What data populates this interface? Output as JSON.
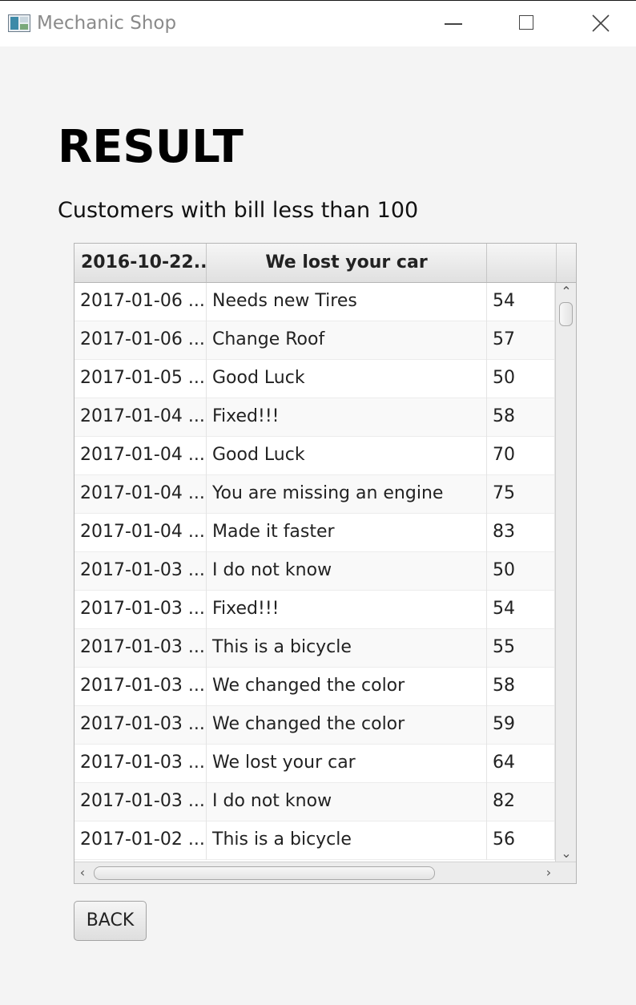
{
  "window": {
    "title": "Mechanic Shop",
    "icon": "app-window-icon",
    "controls": [
      "minimize-icon",
      "maximize-icon",
      "close-icon"
    ]
  },
  "page": {
    "heading": "RESULT",
    "subheading": "Customers with bill less than 100"
  },
  "table": {
    "columns": [
      "2016-10-22...",
      "We lost your car",
      ""
    ],
    "rows": [
      [
        "2017-01-06 ...",
        "Needs new Tires",
        "54"
      ],
      [
        "2017-01-06 ...",
        "Change Roof",
        "57"
      ],
      [
        "2017-01-05 ...",
        "Good Luck",
        "50"
      ],
      [
        "2017-01-04 ...",
        "Fixed!!!",
        "58"
      ],
      [
        "2017-01-04 ...",
        "Good Luck",
        "70"
      ],
      [
        "2017-01-04 ...",
        "You are missing an engine",
        "75"
      ],
      [
        "2017-01-04 ...",
        "Made it faster",
        "83"
      ],
      [
        "2017-01-03 ...",
        "I do not know",
        "50"
      ],
      [
        "2017-01-03 ...",
        "Fixed!!!",
        "54"
      ],
      [
        "2017-01-03 ...",
        "This is a bicycle",
        "55"
      ],
      [
        "2017-01-03 ...",
        "We changed the color",
        "58"
      ],
      [
        "2017-01-03 ...",
        "We changed the color",
        "59"
      ],
      [
        "2017-01-03 ...",
        "We lost your car",
        "64"
      ],
      [
        "2017-01-03 ...",
        "I do not know",
        "82"
      ],
      [
        "2017-01-02 ...",
        "This is a bicycle",
        "56"
      ]
    ],
    "scroll_arrows": {
      "up": "⌃",
      "down": "⌄",
      "left": "‹",
      "right": "›"
    }
  },
  "buttons": {
    "back": "BACK"
  }
}
